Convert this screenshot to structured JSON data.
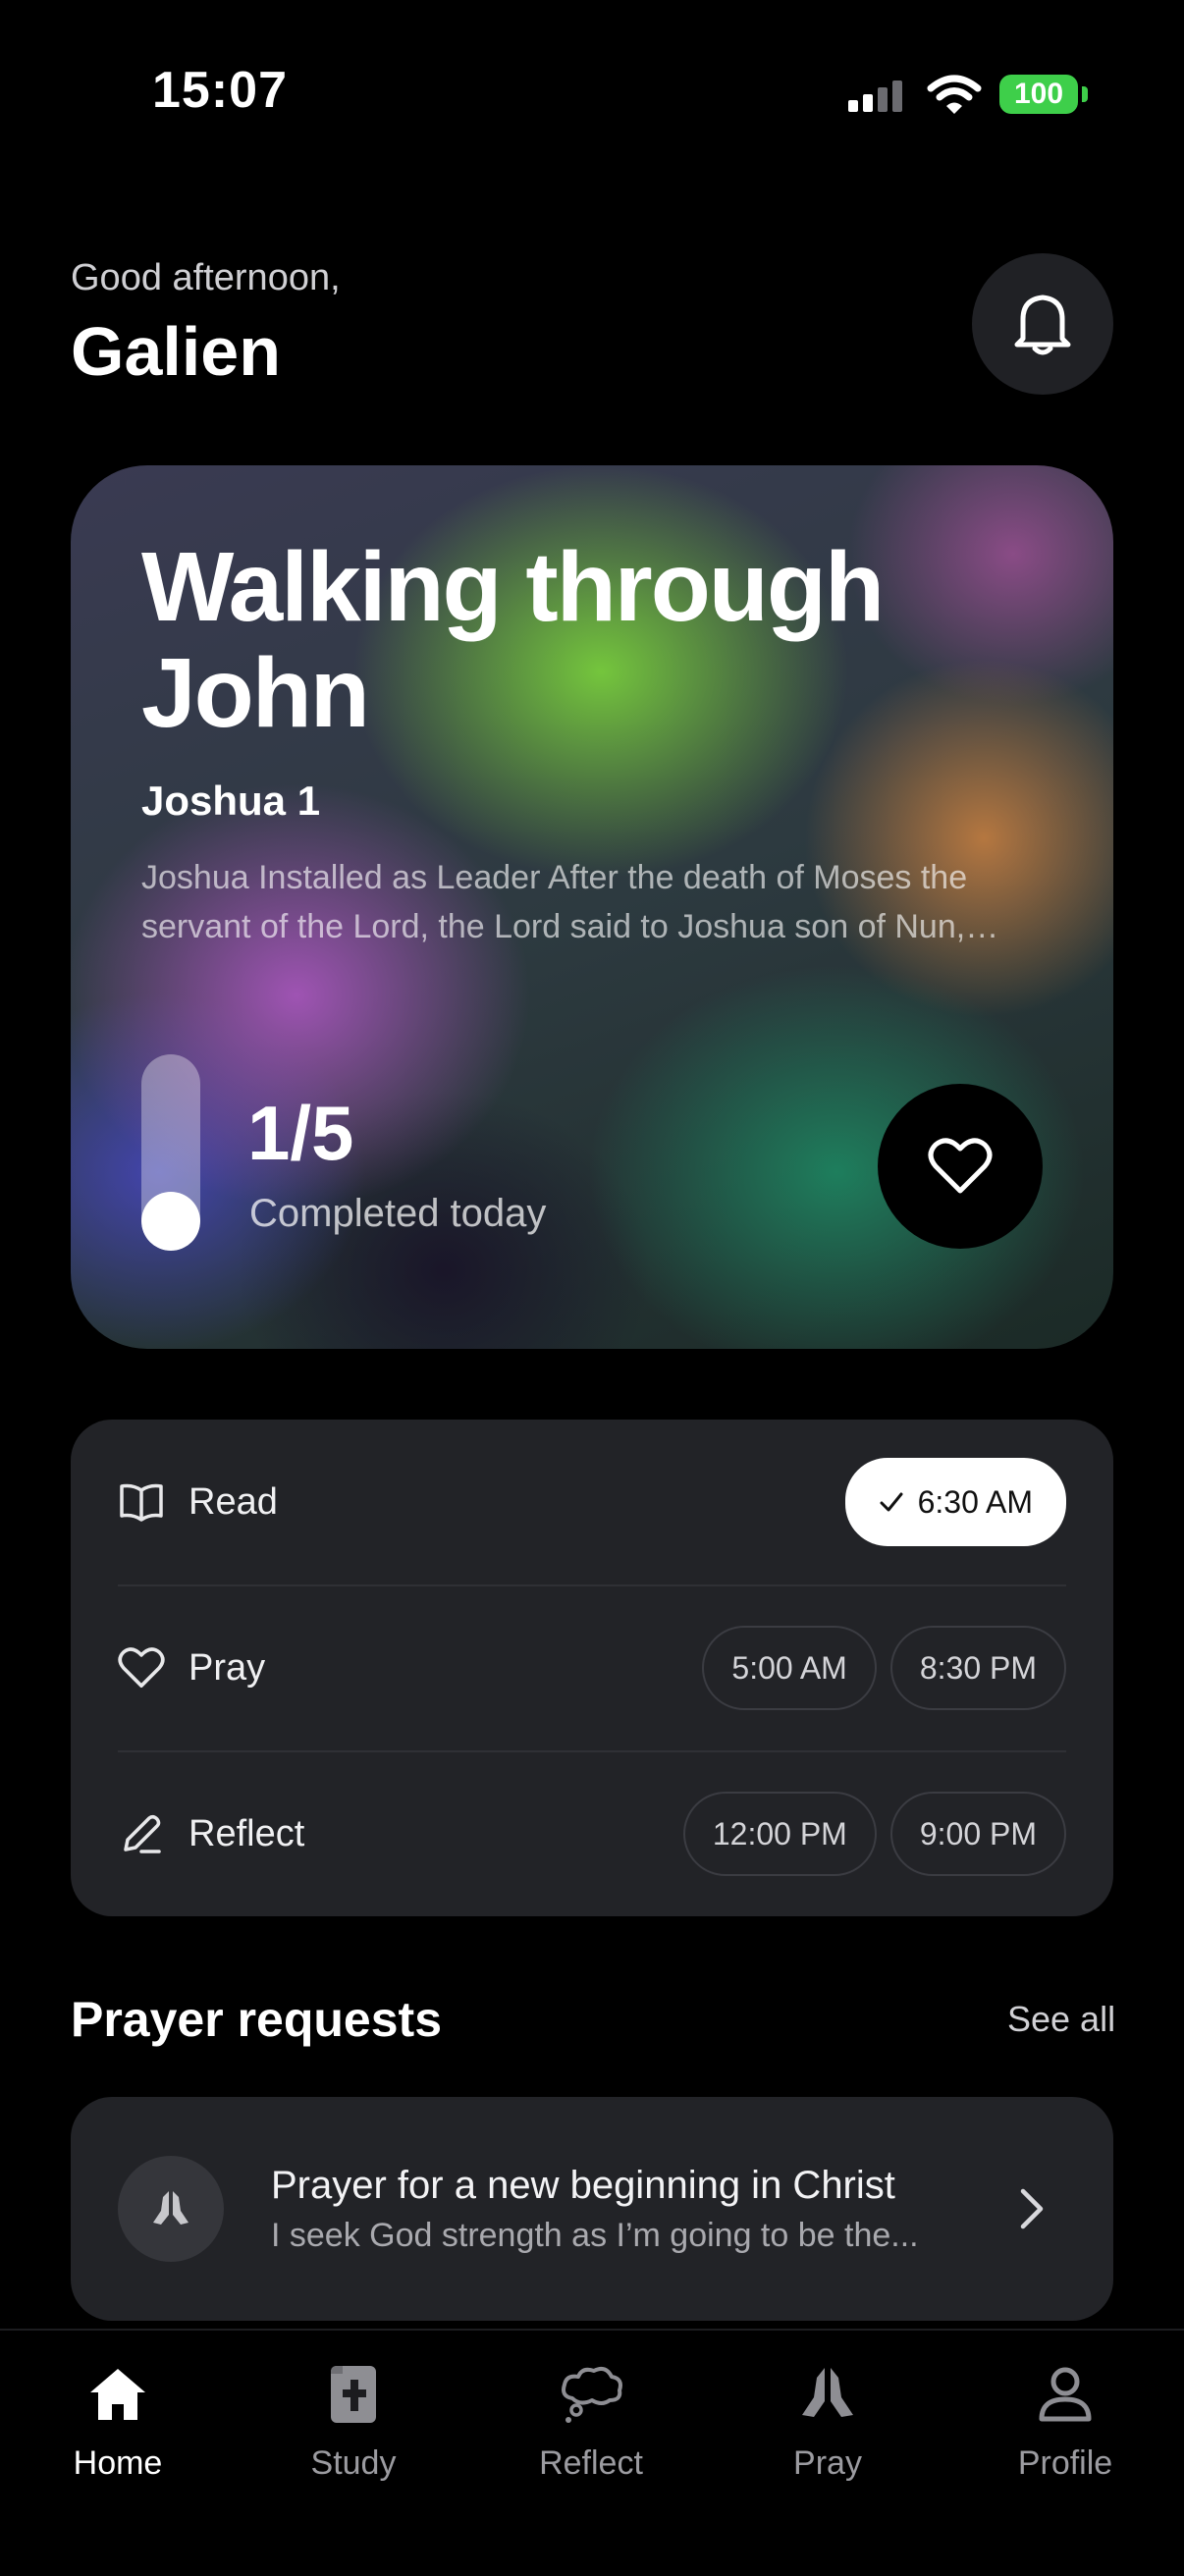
{
  "status_bar": {
    "time": "15:07",
    "battery": "100",
    "battery_color": "#3ecf4a"
  },
  "header": {
    "greeting": "Good afternoon,",
    "name": "Galien",
    "notification_icon": "bell-icon"
  },
  "plan": {
    "title": "Walking through John",
    "chapter": "Joshua 1",
    "excerpt": "Joshua Installed as Leader After the death of Moses the servant of the Lord, the Lord said to Joshua son of Nun, Moses' aide",
    "progress_count": "1/5",
    "progress_label": "Completed today",
    "progress_fraction": 0.2,
    "favorite_icon": "heart-icon"
  },
  "schedule": [
    {
      "label": "Read",
      "icon": "book-icon",
      "times": [
        {
          "label": "6:30 AM",
          "done": true
        }
      ]
    },
    {
      "label": "Pray",
      "icon": "heart-icon",
      "times": [
        {
          "label": "5:00 AM",
          "done": false
        },
        {
          "label": "8:30 PM",
          "done": false
        }
      ]
    },
    {
      "label": "Reflect",
      "icon": "pencil-icon",
      "times": [
        {
          "label": "12:00 PM",
          "done": false
        },
        {
          "label": "9:00 PM",
          "done": false
        }
      ]
    }
  ],
  "prayer_requests": {
    "section_title": "Prayer requests",
    "see_all": "See all",
    "items": [
      {
        "title": "Prayer for a new beginning in Christ",
        "subtitle": "I seek God strength as I’m going to be the...",
        "icon": "praying-hands-icon"
      }
    ]
  },
  "tabs": [
    {
      "label": "Home",
      "icon": "home-icon",
      "active": true
    },
    {
      "label": "Study",
      "icon": "bible-icon",
      "active": false
    },
    {
      "label": "Reflect",
      "icon": "thought-cloud-icon",
      "active": false
    },
    {
      "label": "Pray",
      "icon": "praying-hands-icon",
      "active": false
    },
    {
      "label": "Profile",
      "icon": "person-icon",
      "active": false
    }
  ]
}
